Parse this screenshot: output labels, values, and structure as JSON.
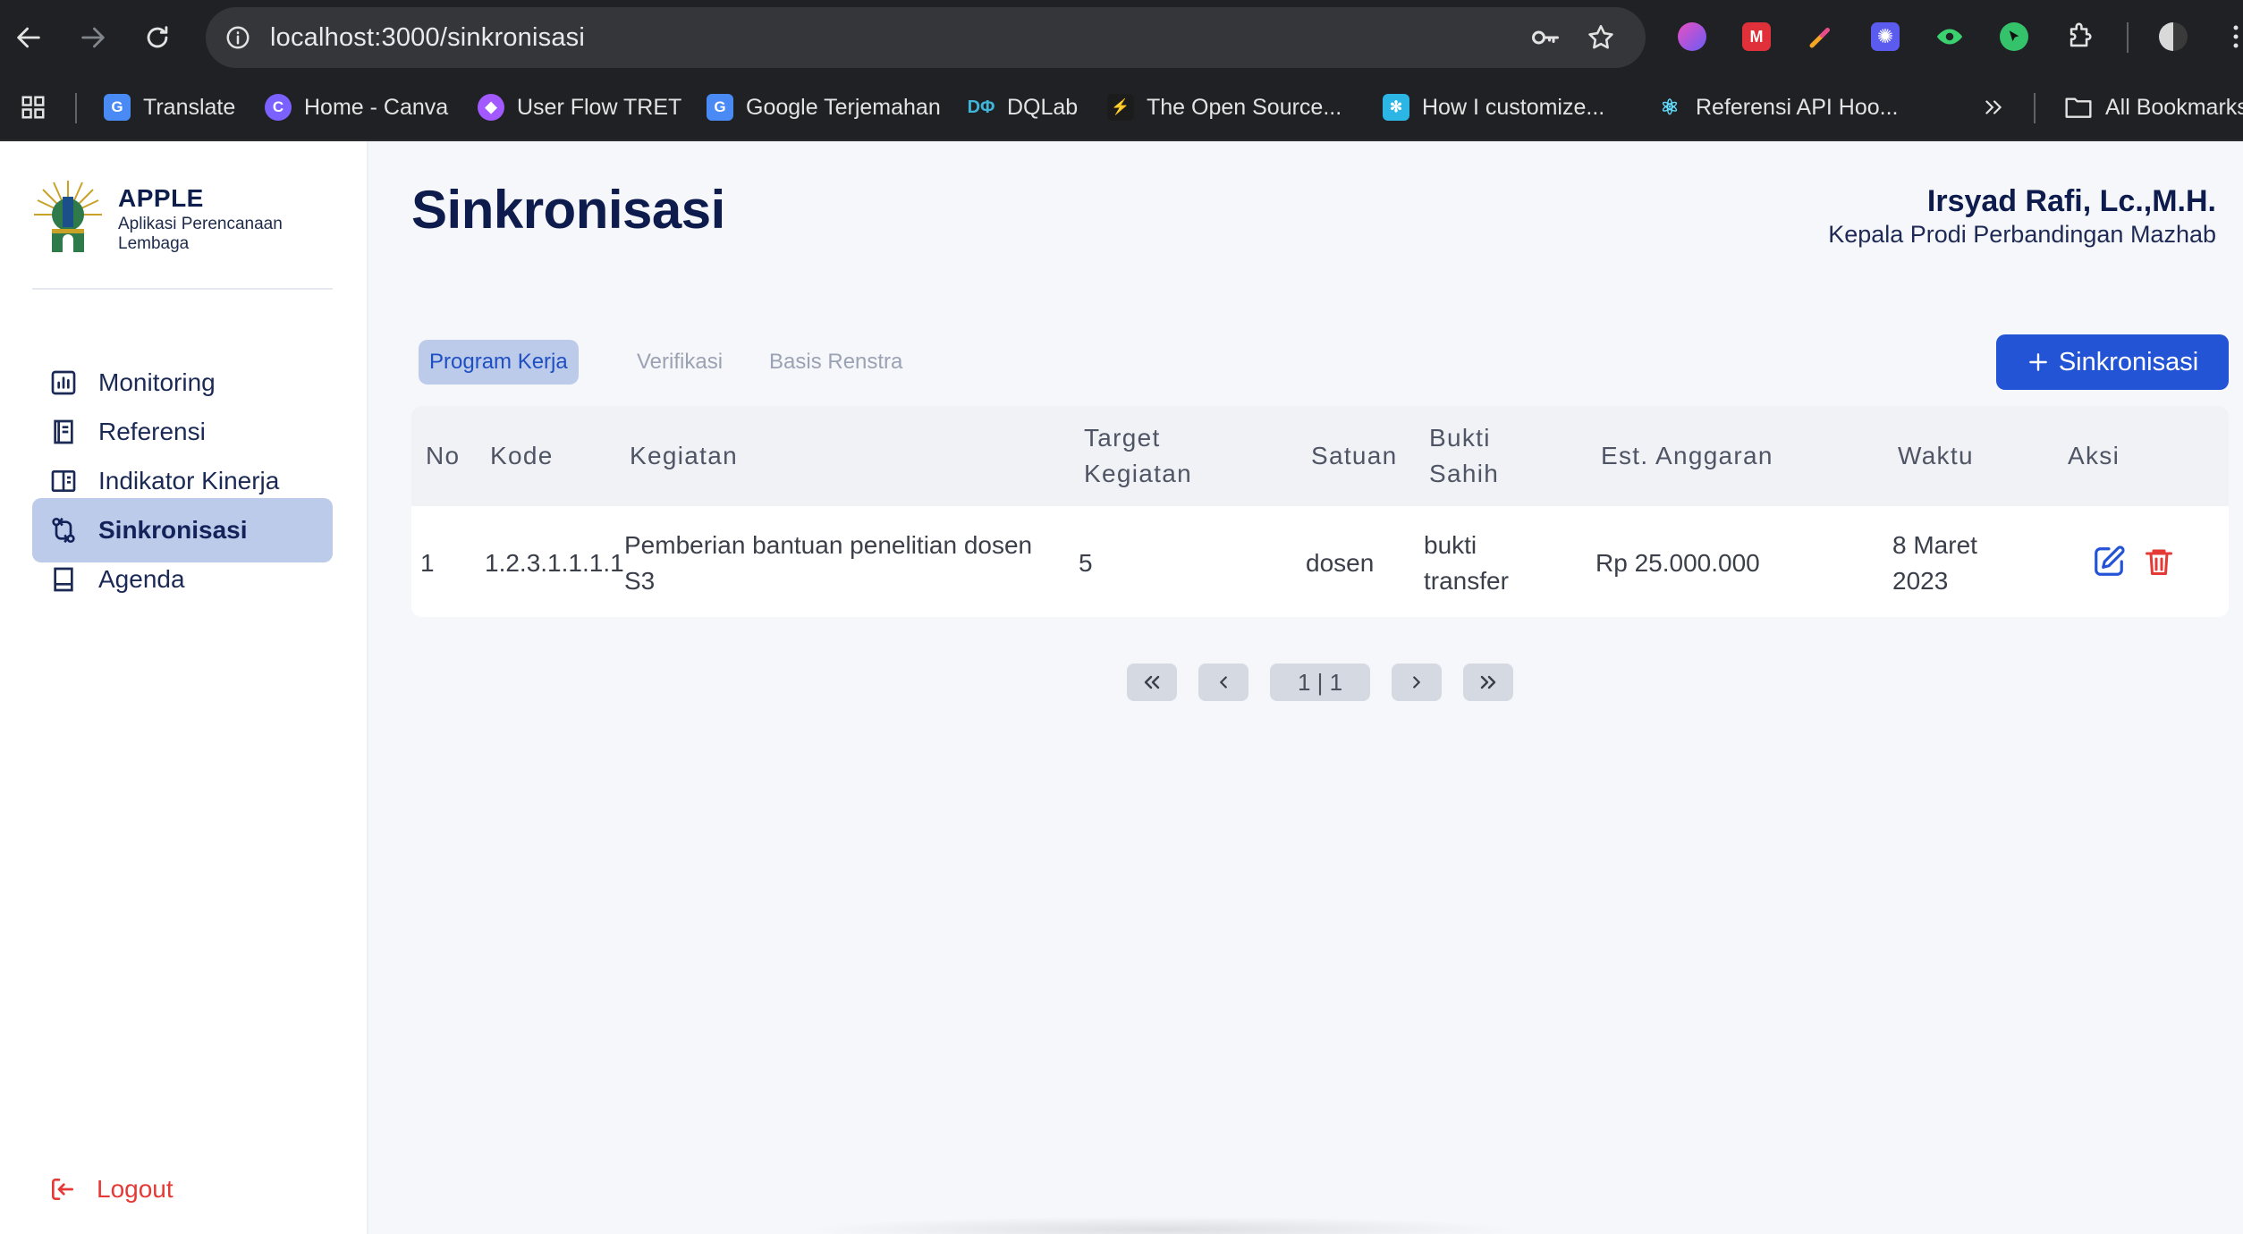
{
  "browser": {
    "url": "localhost:3000/sinkronisasi",
    "bookmarks": [
      {
        "label": "Translate",
        "icon": "google-translate-icon"
      },
      {
        "label": "Home - Canva",
        "icon": "canva-icon"
      },
      {
        "label": "User Flow TRET",
        "icon": "userflow-icon"
      },
      {
        "label": "Google Terjemahan",
        "icon": "google-translate-icon"
      },
      {
        "label": "DQLab",
        "icon": "dqlab-icon"
      },
      {
        "label": "The Open Source...",
        "icon": "supabase-icon"
      },
      {
        "label": "How I customize...",
        "icon": "snowflake-icon"
      },
      {
        "label": "Referensi API Hoo...",
        "icon": "react-icon"
      }
    ],
    "all_bookmarks_label": "All Bookmarks"
  },
  "sidebar": {
    "brand_name": "APPLE",
    "brand_subtitle": "Aplikasi Perencanaan Lembaga",
    "items": [
      {
        "label": "Monitoring",
        "icon": "bar-chart-icon",
        "active": false
      },
      {
        "label": "Referensi",
        "icon": "book-icon",
        "active": false
      },
      {
        "label": "Indikator Kinerja",
        "icon": "open-book-icon",
        "active": false
      },
      {
        "label": "Sinkronisasi",
        "icon": "git-compare-icon",
        "active": true
      },
      {
        "label": "Agenda",
        "icon": "notebook-icon",
        "active": false
      }
    ],
    "logout_label": "Logout"
  },
  "header": {
    "title": "Sinkronisasi",
    "user_name": "Irsyad Rafi, Lc.,M.H.",
    "user_role": "Kepala Prodi Perbandingan Mazhab"
  },
  "tabs": [
    {
      "label": "Program Kerja",
      "active": true
    },
    {
      "label": "Verifikasi",
      "active": false
    },
    {
      "label": "Basis Renstra",
      "active": false
    }
  ],
  "add_button_label": "Sinkronisasi",
  "table": {
    "headers": {
      "no": "No",
      "kode": "Kode",
      "kegiatan": "Kegiatan",
      "target_1": "Target",
      "target_2": "Kegiatan",
      "satuan": "Satuan",
      "bukti_1": "Bukti",
      "bukti_2": "Sahih",
      "anggaran": "Est. Anggaran",
      "waktu": "Waktu",
      "aksi": "Aksi"
    },
    "rows": [
      {
        "no": "1",
        "kode": "1.2.3.1.1.1.1",
        "kegiatan_1": "Pemberian bantuan penelitian dosen",
        "kegiatan_2": "S3",
        "target": "5",
        "satuan": "dosen",
        "bukti_1": "bukti",
        "bukti_2": "transfer",
        "anggaran": "Rp 25.000.000",
        "waktu_1": "8 Maret",
        "waktu_2": "2023"
      }
    ]
  },
  "pagination": {
    "label": "1 | 1"
  },
  "colors": {
    "primary": "#2454d6",
    "active_bg": "#bccbea",
    "title": "#0e1b4d",
    "danger": "#e53935"
  }
}
